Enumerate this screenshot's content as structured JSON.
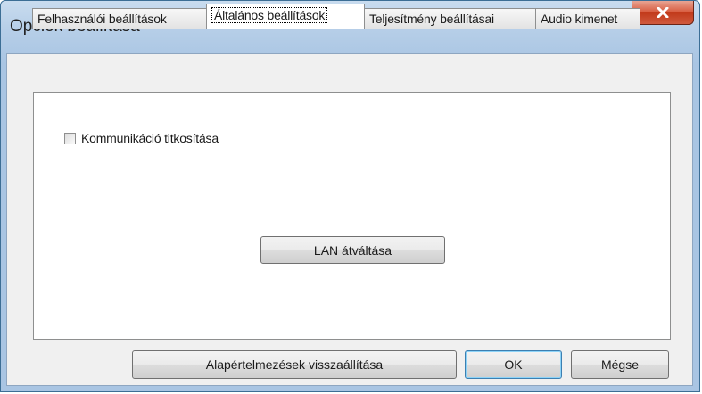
{
  "window": {
    "title": "Opciók beállítása",
    "close_label": "x"
  },
  "tabs": [
    {
      "label": "Felhasználói beállítások"
    },
    {
      "label": "Általános beállítások"
    },
    {
      "label": "Teljesítmény beállításai"
    },
    {
      "label": "Audio kimenet"
    }
  ],
  "active_tab": "Általános beállítások",
  "general": {
    "encryption_checkbox_label": "Kommunikáció titkosítása",
    "encryption_checked": false,
    "lan_button_label": "LAN átváltása"
  },
  "footer": {
    "reset_label": "Alapértelmezések visszaállítása",
    "ok_label": "OK",
    "cancel_label": "Mégse"
  },
  "colors": {
    "close_button": "#c9452a",
    "default_button_border": "#3c7fb1"
  }
}
